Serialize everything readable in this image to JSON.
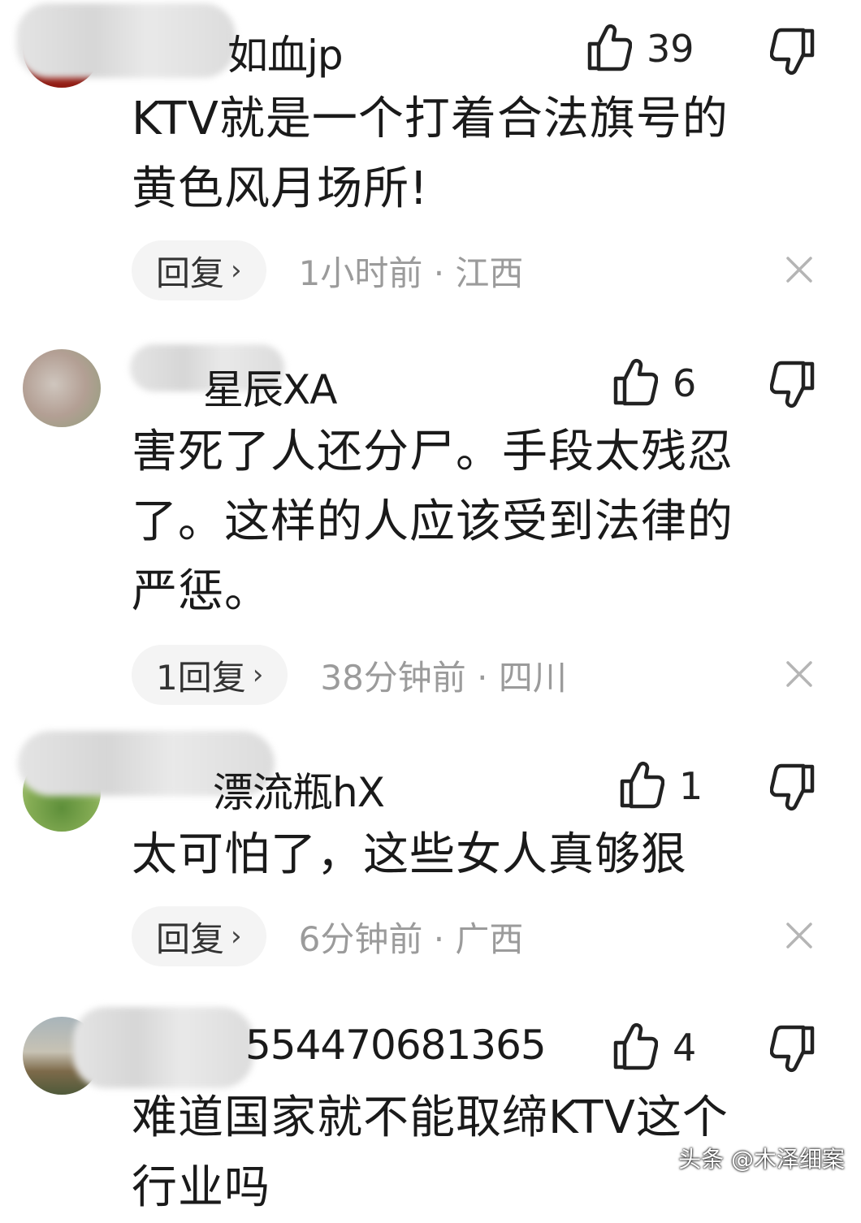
{
  "comments": [
    {
      "username": "如血jp",
      "likes": "39",
      "text_lines": [
        "KTV就是一个打着合法旗号的",
        "黄色风月场所!"
      ],
      "reply_label": "回复",
      "meta": "1小时前 · 江西"
    },
    {
      "username": "星辰XA",
      "likes": "6",
      "text_lines": [
        "害死了人还分尸。手段太残忍",
        "了。这样的人应该受到法律的",
        "严惩。"
      ],
      "reply_label": "1回复",
      "meta": "38分钟前 · 四川"
    },
    {
      "username": "漂流瓶hX",
      "likes": "1",
      "text_lines": [
        "太可怕了，这些女人真够狠"
      ],
      "reply_label": "回复",
      "meta": "6分钟前 · 广西"
    },
    {
      "username": "554470681365",
      "likes": "4",
      "text_lines": [
        "难道国家就不能取缔KTV这个",
        "行业吗"
      ],
      "reply_label": "",
      "meta": ""
    }
  ],
  "icons": {
    "like": "thumbs-up-icon",
    "dislike": "thumbs-down-icon",
    "close": "close-icon",
    "chevron": "chevron-right-icon"
  },
  "watermark": "头条 @木泽细案",
  "colors": {
    "text": "#1a1a1a",
    "meta": "#9b9b9b",
    "pill_bg": "#f4f4f4"
  }
}
